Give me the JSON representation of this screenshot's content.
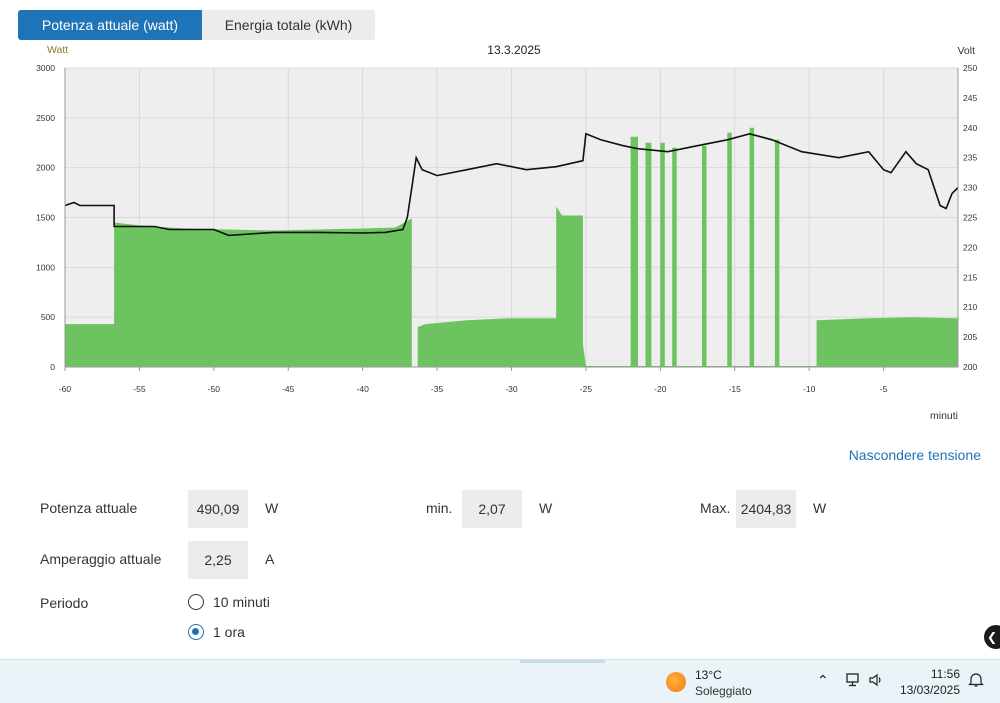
{
  "tabs": [
    {
      "label": "Potenza attuale (watt)",
      "active": true
    },
    {
      "label": "Energia totale (kWh)",
      "active": false
    }
  ],
  "chart_data": {
    "type": "area+line",
    "title": "13.3.2025",
    "left_axis_label": "Watt",
    "right_axis_label": "Volt",
    "x_axis_label": "minuti",
    "y_left_ticks": [
      "0",
      "500",
      "1000",
      "1500",
      "2000",
      "2500",
      "3000"
    ],
    "y_right_ticks": [
      "200",
      "205",
      "210",
      "215",
      "220",
      "225",
      "230",
      "235",
      "240",
      "245",
      "250"
    ],
    "x_ticks": [
      "-60",
      "-55",
      "-50",
      "-45",
      "-40",
      "-35",
      "-30",
      "-25",
      "-20",
      "-15",
      "-10",
      "-5"
    ],
    "xlim": [
      -60,
      0
    ],
    "ylim_left": [
      0,
      3000
    ],
    "ylim_right": [
      200,
      250
    ],
    "grid": true,
    "colors": {
      "power_fill": "#6cc35f",
      "voltage_line": "#111111",
      "plot_bg": "#eeeeee",
      "grid": "#d9d9d9"
    },
    "series": [
      {
        "name": "Watt",
        "kind": "area",
        "points": [
          [
            -60.0,
            0
          ],
          [
            -60.0,
            430
          ],
          [
            -56.7,
            430
          ],
          [
            -56.7,
            1450
          ],
          [
            -55.0,
            1420
          ],
          [
            -52.0,
            1390
          ],
          [
            -49.0,
            1380
          ],
          [
            -46.0,
            1370
          ],
          [
            -43.0,
            1380
          ],
          [
            -40.0,
            1390
          ],
          [
            -37.8,
            1400
          ],
          [
            -36.7,
            1490
          ],
          [
            -36.7,
            0
          ],
          [
            -36.3,
            0
          ],
          [
            -36.3,
            400
          ],
          [
            -35.8,
            430
          ],
          [
            -33.0,
            470
          ],
          [
            -30.0,
            490
          ],
          [
            -27.0,
            490
          ],
          [
            -27.0,
            1610
          ],
          [
            -26.6,
            1520
          ],
          [
            -25.2,
            1520
          ],
          [
            -25.2,
            230
          ],
          [
            -25.0,
            10
          ],
          [
            -22.0,
            10
          ],
          [
            -22.0,
            2310
          ],
          [
            -21.5,
            2310
          ],
          [
            -21.5,
            10
          ],
          [
            -21.0,
            10
          ],
          [
            -21.0,
            2250
          ],
          [
            -20.6,
            2250
          ],
          [
            -20.6,
            10
          ],
          [
            -20.0,
            10
          ],
          [
            -20.0,
            2250
          ],
          [
            -19.7,
            2250
          ],
          [
            -19.7,
            10
          ],
          [
            -19.2,
            10
          ],
          [
            -19.2,
            2200
          ],
          [
            -18.9,
            2200
          ],
          [
            -18.9,
            10
          ],
          [
            -17.2,
            10
          ],
          [
            -17.2,
            2220
          ],
          [
            -16.9,
            2220
          ],
          [
            -16.9,
            10
          ],
          [
            -15.5,
            10
          ],
          [
            -15.5,
            2350
          ],
          [
            -15.2,
            2350
          ],
          [
            -15.2,
            10
          ],
          [
            -14.0,
            10
          ],
          [
            -14.0,
            2400
          ],
          [
            -13.7,
            2400
          ],
          [
            -13.7,
            10
          ],
          [
            -12.3,
            10
          ],
          [
            -12.3,
            2280
          ],
          [
            -12.0,
            2280
          ],
          [
            -12.0,
            10
          ],
          [
            -9.5,
            10
          ],
          [
            -9.5,
            470
          ],
          [
            -6.0,
            490
          ],
          [
            -3.0,
            500
          ],
          [
            0,
            490
          ],
          [
            0,
            0
          ]
        ]
      },
      {
        "name": "Volt",
        "kind": "line",
        "points": [
          [
            -60.0,
            227
          ],
          [
            -59.4,
            227.5
          ],
          [
            -59.0,
            227
          ],
          [
            -56.7,
            227
          ],
          [
            -56.7,
            223.5
          ],
          [
            -54.0,
            223.5
          ],
          [
            -53.0,
            223
          ],
          [
            -50.0,
            223
          ],
          [
            -49.0,
            222
          ],
          [
            -46.0,
            222.5
          ],
          [
            -43.0,
            222.5
          ],
          [
            -40.0,
            222.4
          ],
          [
            -38.5,
            222.5
          ],
          [
            -37.3,
            223
          ],
          [
            -37.0,
            225
          ],
          [
            -36.7,
            230
          ],
          [
            -36.4,
            235
          ],
          [
            -36.0,
            233
          ],
          [
            -35.0,
            232
          ],
          [
            -33.0,
            233
          ],
          [
            -31.0,
            234
          ],
          [
            -29.0,
            233
          ],
          [
            -27.0,
            233.5
          ],
          [
            -25.2,
            234.5
          ],
          [
            -25.0,
            239
          ],
          [
            -24.0,
            238
          ],
          [
            -22.5,
            237
          ],
          [
            -21.5,
            236.5
          ],
          [
            -19.5,
            236
          ],
          [
            -17.5,
            237
          ],
          [
            -15.5,
            238
          ],
          [
            -14.0,
            239
          ],
          [
            -12.5,
            238
          ],
          [
            -10.5,
            236
          ],
          [
            -8.0,
            235
          ],
          [
            -6.0,
            236
          ],
          [
            -5.0,
            233
          ],
          [
            -4.5,
            232.5
          ],
          [
            -3.5,
            236
          ],
          [
            -2.8,
            234
          ],
          [
            -2.0,
            233
          ],
          [
            -1.2,
            227
          ],
          [
            -0.8,
            226.5
          ],
          [
            -0.4,
            229
          ],
          [
            0,
            230
          ]
        ]
      }
    ]
  },
  "toggle_voltage_label": "Nascondere tensione",
  "stats": {
    "current_power_label": "Potenza attuale",
    "current_power_value": "490,09",
    "current_power_unit": "W",
    "min_label": "min.",
    "min_value": "2,07",
    "min_unit": "W",
    "max_label": "Max.",
    "max_value": "2404,83",
    "max_unit": "W",
    "current_amp_label": "Amperaggio attuale",
    "current_amp_value": "2,25",
    "current_amp_unit": "A",
    "period_label": "Periodo",
    "period_options": [
      {
        "label": "10 minuti",
        "selected": false
      },
      {
        "label": "1 ora",
        "selected": true
      }
    ]
  },
  "taskbar": {
    "weather_temp": "13°C",
    "weather_desc": "Soleggiato",
    "time": "11:56",
    "date": "13/03/2025"
  }
}
